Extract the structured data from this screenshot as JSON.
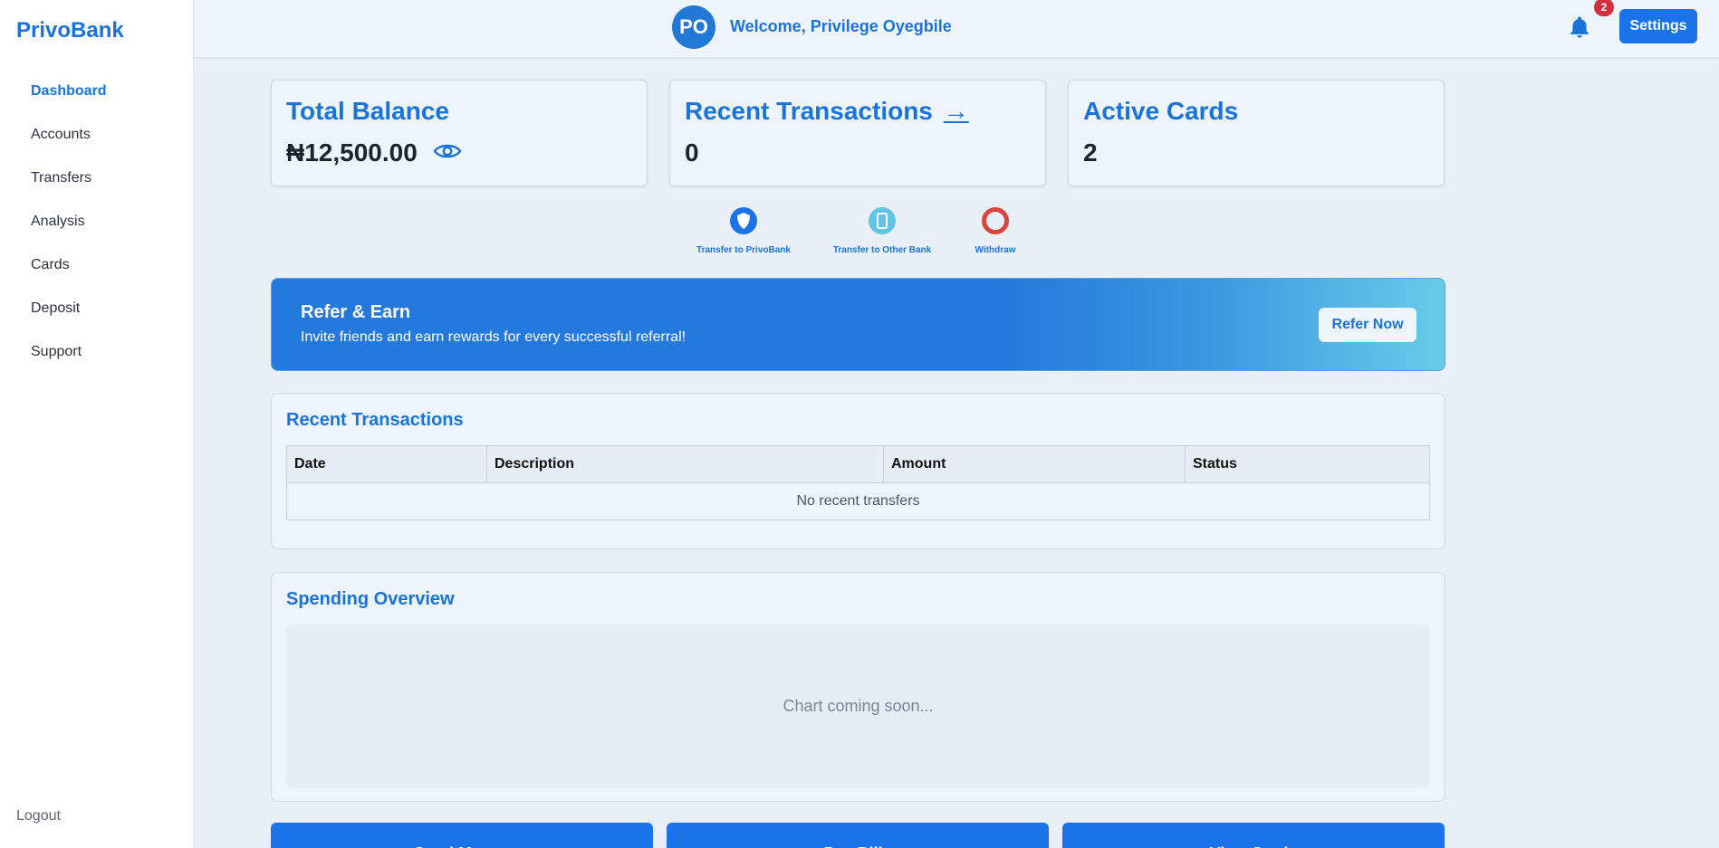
{
  "app": {
    "brand": "PrivoBank"
  },
  "sidebar": {
    "items": [
      {
        "label": "Dashboard",
        "active": true
      },
      {
        "label": "Accounts"
      },
      {
        "label": "Transfers"
      },
      {
        "label": "Analysis"
      },
      {
        "label": "Cards"
      },
      {
        "label": "Deposit"
      },
      {
        "label": "Support"
      }
    ],
    "logout_label": "Logout"
  },
  "header": {
    "avatar_initials": "PO",
    "welcome": "Welcome, Privilege Oyegbile",
    "notification_count": "2",
    "settings_label": "Settings"
  },
  "cards": {
    "balance": {
      "title": "Total Balance",
      "value": "₦12,500.00"
    },
    "transactions": {
      "title": "Recent Transactions",
      "arrow": "→",
      "value": "0"
    },
    "active_cards": {
      "title": "Active Cards",
      "value": "2"
    }
  },
  "quick_actions": [
    {
      "label": "Transfer to PrivoBank",
      "icon": "shield-icon",
      "color": "#1a73e8"
    },
    {
      "label": "Transfer to Other Bank",
      "icon": "tablet-icon",
      "color": "#5fc4e6"
    },
    {
      "label": "Withdraw",
      "icon": "ring-icon",
      "color": "#d9453b"
    }
  ],
  "referral": {
    "title": "Refer & Earn",
    "text": "Invite friends and earn rewards for every successful referral!",
    "button_label": "Refer Now"
  },
  "transactions_panel": {
    "title": "Recent Transactions",
    "columns": [
      "Date",
      "Description",
      "Amount",
      "Status"
    ],
    "empty_text": "No recent transfers"
  },
  "spending_panel": {
    "title": "Spending Overview",
    "placeholder": "Chart coming soon..."
  },
  "bottom_actions": [
    {
      "label": "Send Money"
    },
    {
      "label": "Pay Bills"
    },
    {
      "label": "View Cards"
    }
  ],
  "colors": {
    "accent": "#1a73e8",
    "badge": "#d32f3f",
    "background": "#e9eff7"
  }
}
